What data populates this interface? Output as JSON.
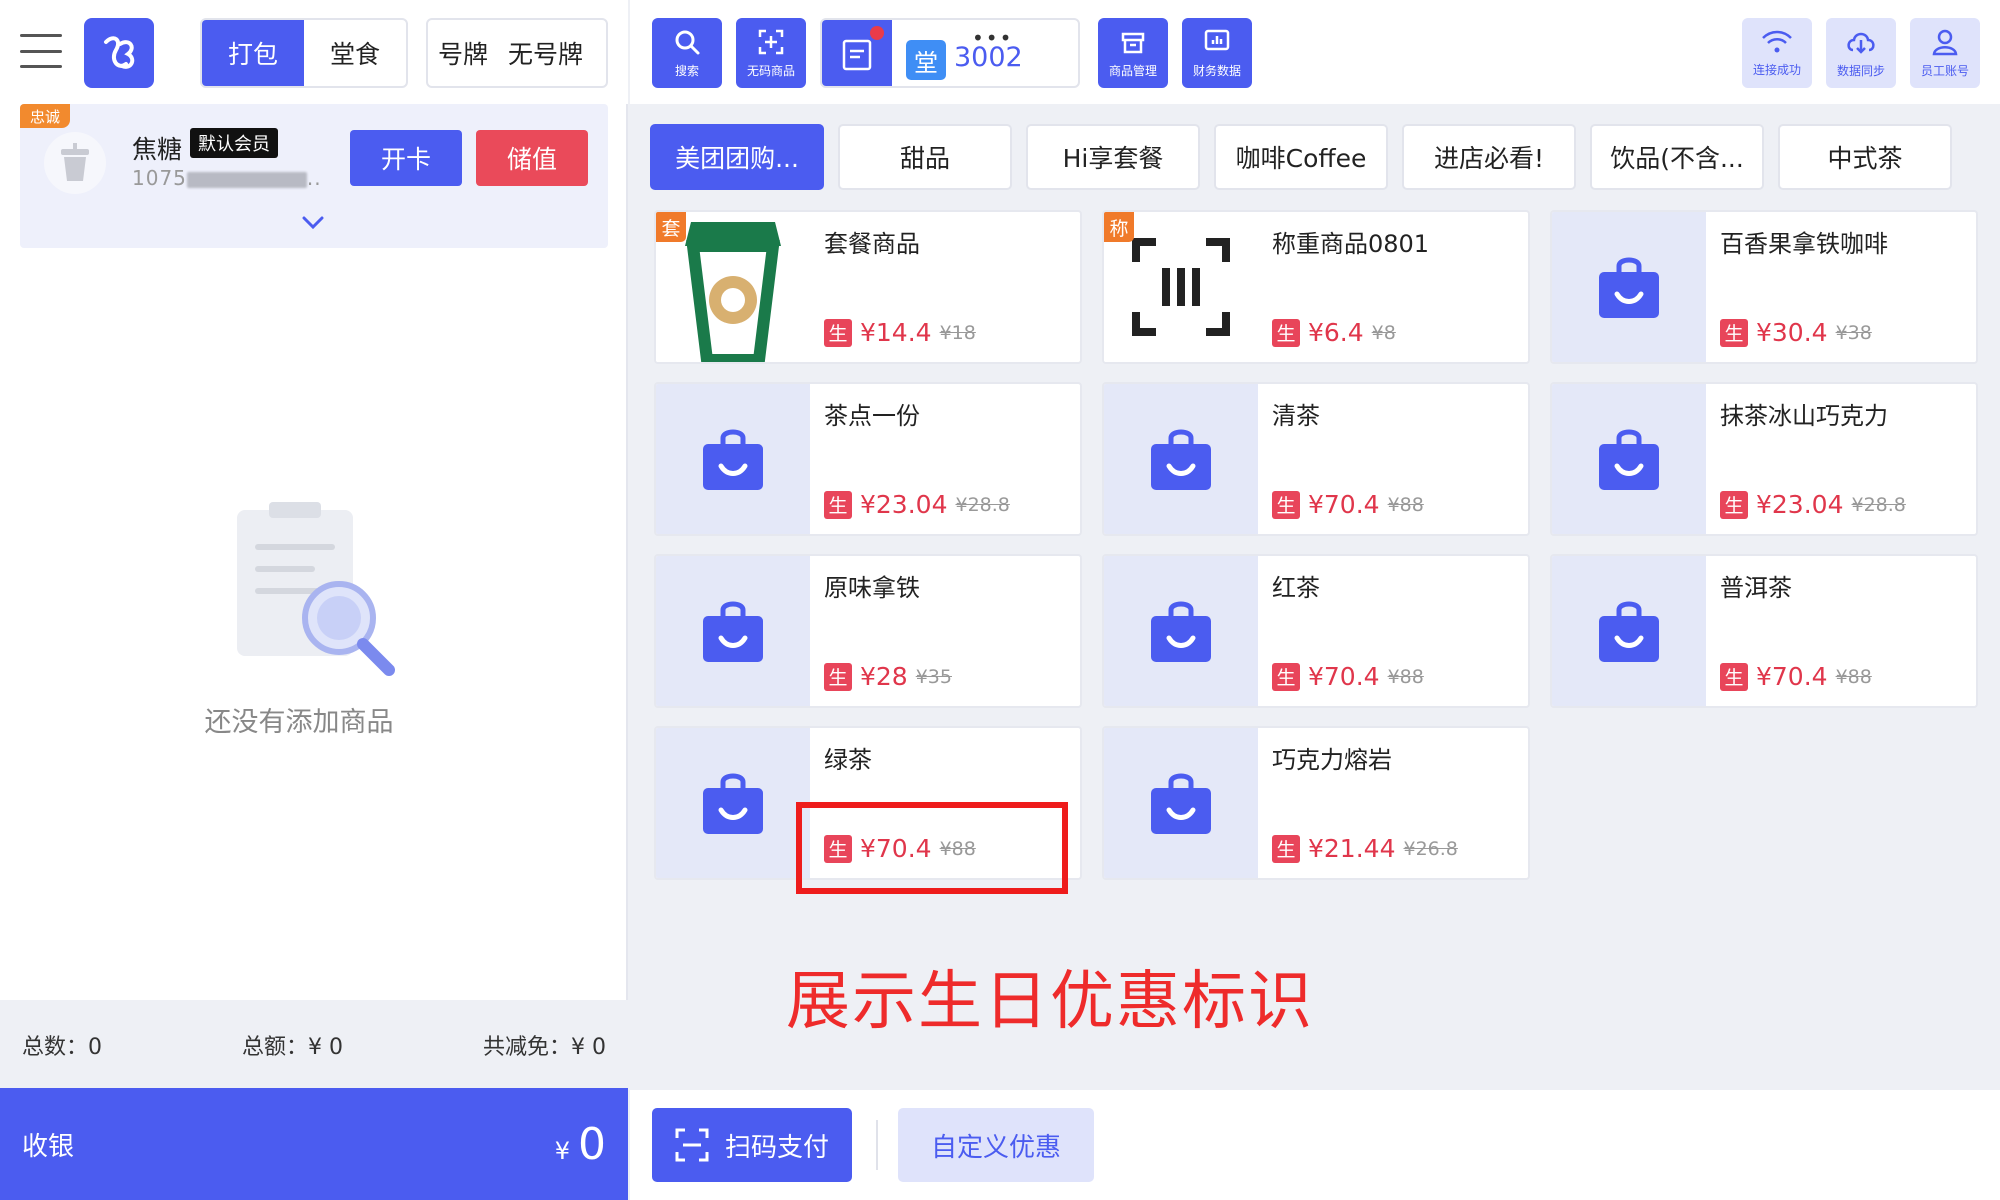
{
  "mode_tabs": [
    {
      "label": "打包",
      "active": true
    },
    {
      "label": "堂食",
      "active": false
    }
  ],
  "plate_tabs": [
    {
      "label": "号牌"
    },
    {
      "label": "无号牌"
    }
  ],
  "member": {
    "tag": "忠诚",
    "name": "焦糖",
    "badge": "默认会员",
    "phone_prefix": "1075",
    "phone_suffix": "..",
    "open_card_label": "开卡",
    "recharge_label": "储值"
  },
  "empty_text": "还没有添加商品",
  "summary": {
    "count": "总数：0",
    "amount": "总额：¥ 0",
    "discount": "共减免：¥ 0"
  },
  "checkout": {
    "label": "收银",
    "currency": "¥",
    "value": "0"
  },
  "toolbar": {
    "search_label": "搜索",
    "nocode_label": "无码商品",
    "table_tag": "堂",
    "table_number": "3002",
    "table_more": "•••",
    "goods_mgmt_label": "商品管理",
    "finance_label": "财务数据",
    "wifi_label": "连接成功",
    "sync_label": "数据同步",
    "staff_label": "员工账号"
  },
  "categories": [
    {
      "label": "美团团购...",
      "active": true
    },
    {
      "label": "甜品",
      "active": false
    },
    {
      "label": "Hi享套餐",
      "active": false
    },
    {
      "label": "咖啡Coffee",
      "active": false
    },
    {
      "label": "进店必看!",
      "active": false
    },
    {
      "label": "饮品(不含...",
      "active": false
    },
    {
      "label": "中式茶",
      "active": false
    }
  ],
  "products": [
    {
      "name": "套餐商品",
      "corner": "套",
      "price": "¥14.4",
      "orig": "¥18",
      "mark": "生",
      "icon": "cup-icon"
    },
    {
      "name": "称重商品0801",
      "corner": "称",
      "price": "¥6.4",
      "orig": "¥8",
      "mark": "生",
      "icon": "scale-icon"
    },
    {
      "name": "百香果拿铁咖啡",
      "corner": "",
      "price": "¥30.4",
      "orig": "¥38",
      "mark": "生",
      "icon": "shopping-bag-icon"
    },
    {
      "name": "茶点一份",
      "corner": "",
      "price": "¥23.04",
      "orig": "¥28.8",
      "mark": "生",
      "icon": "shopping-bag-icon"
    },
    {
      "name": "清茶",
      "corner": "",
      "price": "¥70.4",
      "orig": "¥88",
      "mark": "生",
      "icon": "shopping-bag-icon"
    },
    {
      "name": "抹茶冰山巧克力",
      "corner": "",
      "price": "¥23.04",
      "orig": "¥28.8",
      "mark": "生",
      "icon": "shopping-bag-icon"
    },
    {
      "name": "原味拿铁",
      "corner": "",
      "price": "¥28",
      "orig": "¥35",
      "mark": "生",
      "icon": "shopping-bag-icon"
    },
    {
      "name": "红茶",
      "corner": "",
      "price": "¥70.4",
      "orig": "¥88",
      "mark": "生",
      "icon": "shopping-bag-icon"
    },
    {
      "name": "普洱茶",
      "corner": "",
      "price": "¥70.4",
      "orig": "¥88",
      "mark": "生",
      "icon": "shopping-bag-icon"
    },
    {
      "name": "绿茶",
      "corner": "",
      "price": "¥70.4",
      "orig": "¥88",
      "mark": "生",
      "icon": "shopping-bag-icon"
    },
    {
      "name": "巧克力熔岩",
      "corner": "",
      "price": "¥21.44",
      "orig": "¥26.8",
      "mark": "生",
      "icon": "shopping-bag-icon"
    }
  ],
  "annotation": "展示生日优惠标识",
  "bottom": {
    "pay_label": "扫码支付",
    "custom_label": "自定义优惠"
  },
  "colors": {
    "accent": "#4b5cf0",
    "danger": "#ea4a5a",
    "price": "#e0364b",
    "annotation": "#ee2b2b"
  }
}
